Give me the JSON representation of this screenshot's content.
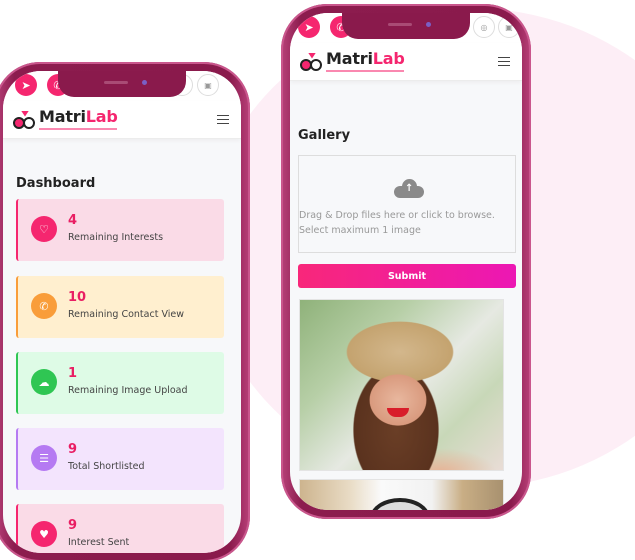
{
  "brand": {
    "name_part1": "Matri",
    "name_part2": "Lab",
    "accent_color": "#f5266f",
    "frame_color": "#8a1a4c"
  },
  "topbar": {
    "left_icons": [
      "telegram-icon",
      "phone-icon"
    ],
    "right_icons": [
      "instagram-icon",
      "linkedin-icon"
    ]
  },
  "dashboard": {
    "title": "Dashboard",
    "cards": [
      {
        "value": "4",
        "label": "Remaining Interests",
        "icon": "heart-icon",
        "bg": "#fadbe7",
        "accent": "#f5266f"
      },
      {
        "value": "10",
        "label": "Remaining Contact View",
        "icon": "phone-icon",
        "bg": "#ffefcf",
        "accent": "#f99d3a"
      },
      {
        "value": "1",
        "label": "Remaining Image Upload",
        "icon": "cloud-upload-icon",
        "bg": "#defbe6",
        "accent": "#2fc653"
      },
      {
        "value": "9",
        "label": "Total Shortlisted",
        "icon": "list-icon",
        "bg": "#f3e4fd",
        "accent": "#b57af2"
      },
      {
        "value": "9",
        "label": "Interest Sent",
        "icon": "heartbeat-icon",
        "bg": "#fadbe7",
        "accent": "#f5266f"
      }
    ]
  },
  "gallery": {
    "title": "Gallery",
    "dropzone_line1": "Drag & Drop files here or click to browse.",
    "dropzone_line2": "Select maximum 1 image",
    "submit_label": "Submit"
  }
}
